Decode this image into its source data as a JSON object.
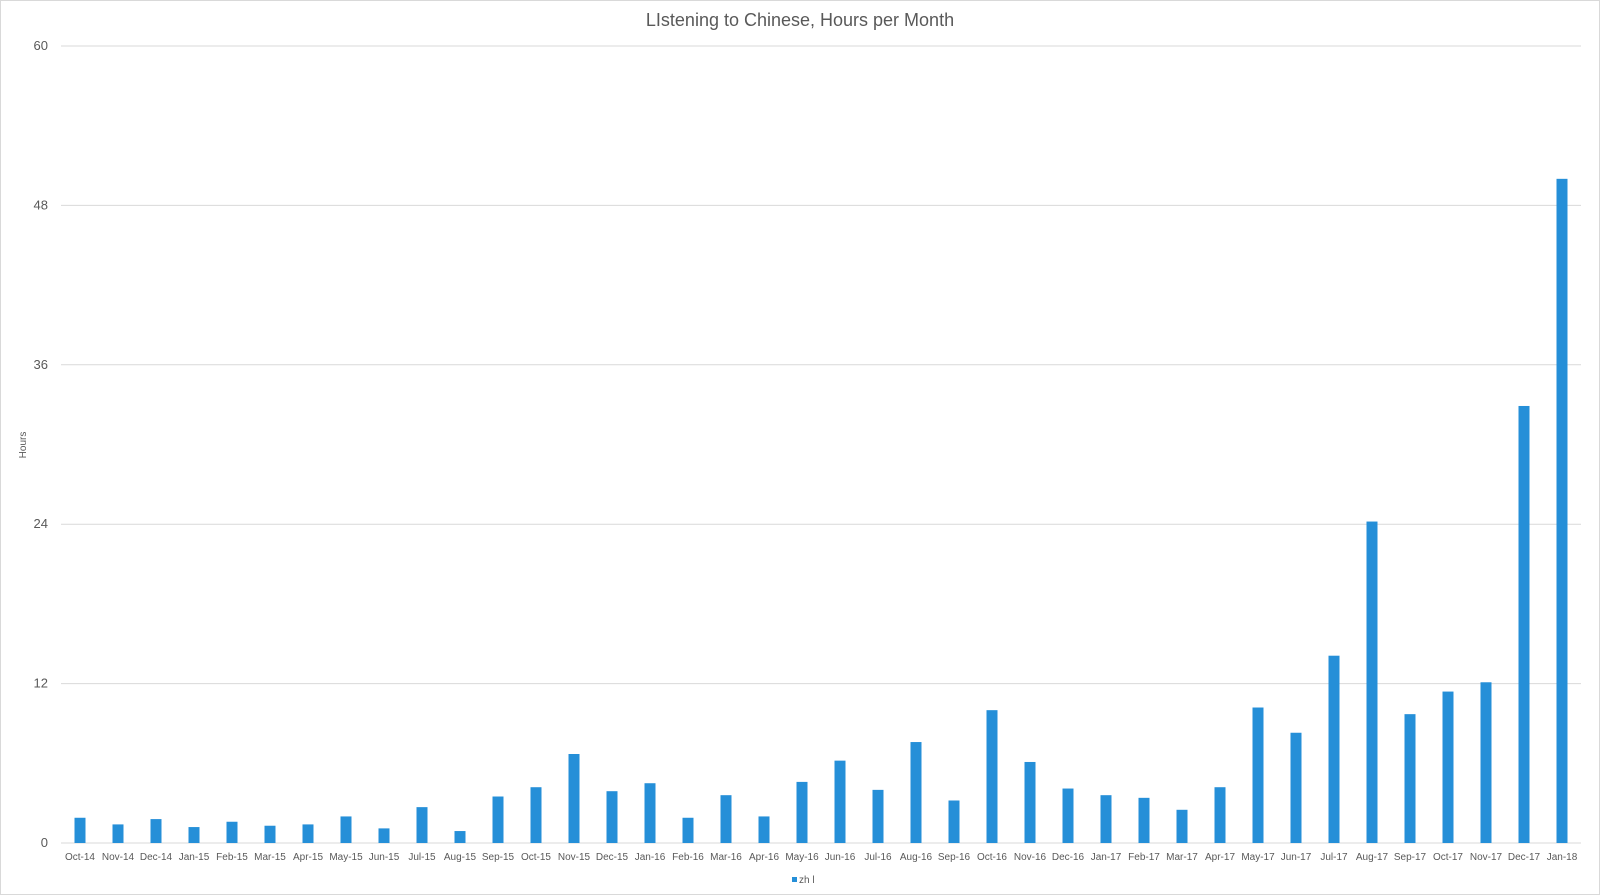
{
  "chart_data": {
    "type": "bar",
    "title": "LIstening to Chinese, Hours per Month",
    "xlabel": "",
    "ylabel": "Hours",
    "ylim": [
      0,
      60
    ],
    "yticks": [
      "0",
      "12",
      "24",
      "36",
      "48",
      "60"
    ],
    "grid": true,
    "legend_position": "bottom",
    "bar_color": "#258fd8",
    "grid_color": "#d9d9d9",
    "categories": [
      "Oct-14",
      "Nov-14",
      "Dec-14",
      "Jan-15",
      "Feb-15",
      "Mar-15",
      "Apr-15",
      "May-15",
      "Jun-15",
      "Jul-15",
      "Aug-15",
      "Sep-15",
      "Oct-15",
      "Nov-15",
      "Dec-15",
      "Jan-16",
      "Feb-16",
      "Mar-16",
      "Apr-16",
      "May-16",
      "Jun-16",
      "Jul-16",
      "Aug-16",
      "Sep-16",
      "Oct-16",
      "Nov-16",
      "Dec-16",
      "Jan-17",
      "Feb-17",
      "Mar-17",
      "Apr-17",
      "May-17",
      "Jun-17",
      "Jul-17",
      "Aug-17",
      "Sep-17",
      "Oct-17",
      "Nov-17",
      "Dec-17",
      "Jan-18"
    ],
    "series": [
      {
        "name": "zh l",
        "values": [
          1.9,
          1.4,
          1.8,
          1.2,
          1.6,
          1.3,
          1.4,
          2.0,
          1.1,
          2.7,
          0.9,
          3.5,
          4.2,
          6.7,
          3.9,
          4.5,
          1.9,
          3.6,
          2.0,
          4.6,
          6.2,
          4.0,
          7.6,
          3.2,
          10.0,
          6.1,
          4.1,
          3.6,
          3.4,
          2.5,
          4.2,
          10.2,
          8.3,
          14.1,
          24.2,
          9.7,
          11.4,
          12.1,
          32.9,
          50.0
        ]
      }
    ]
  }
}
